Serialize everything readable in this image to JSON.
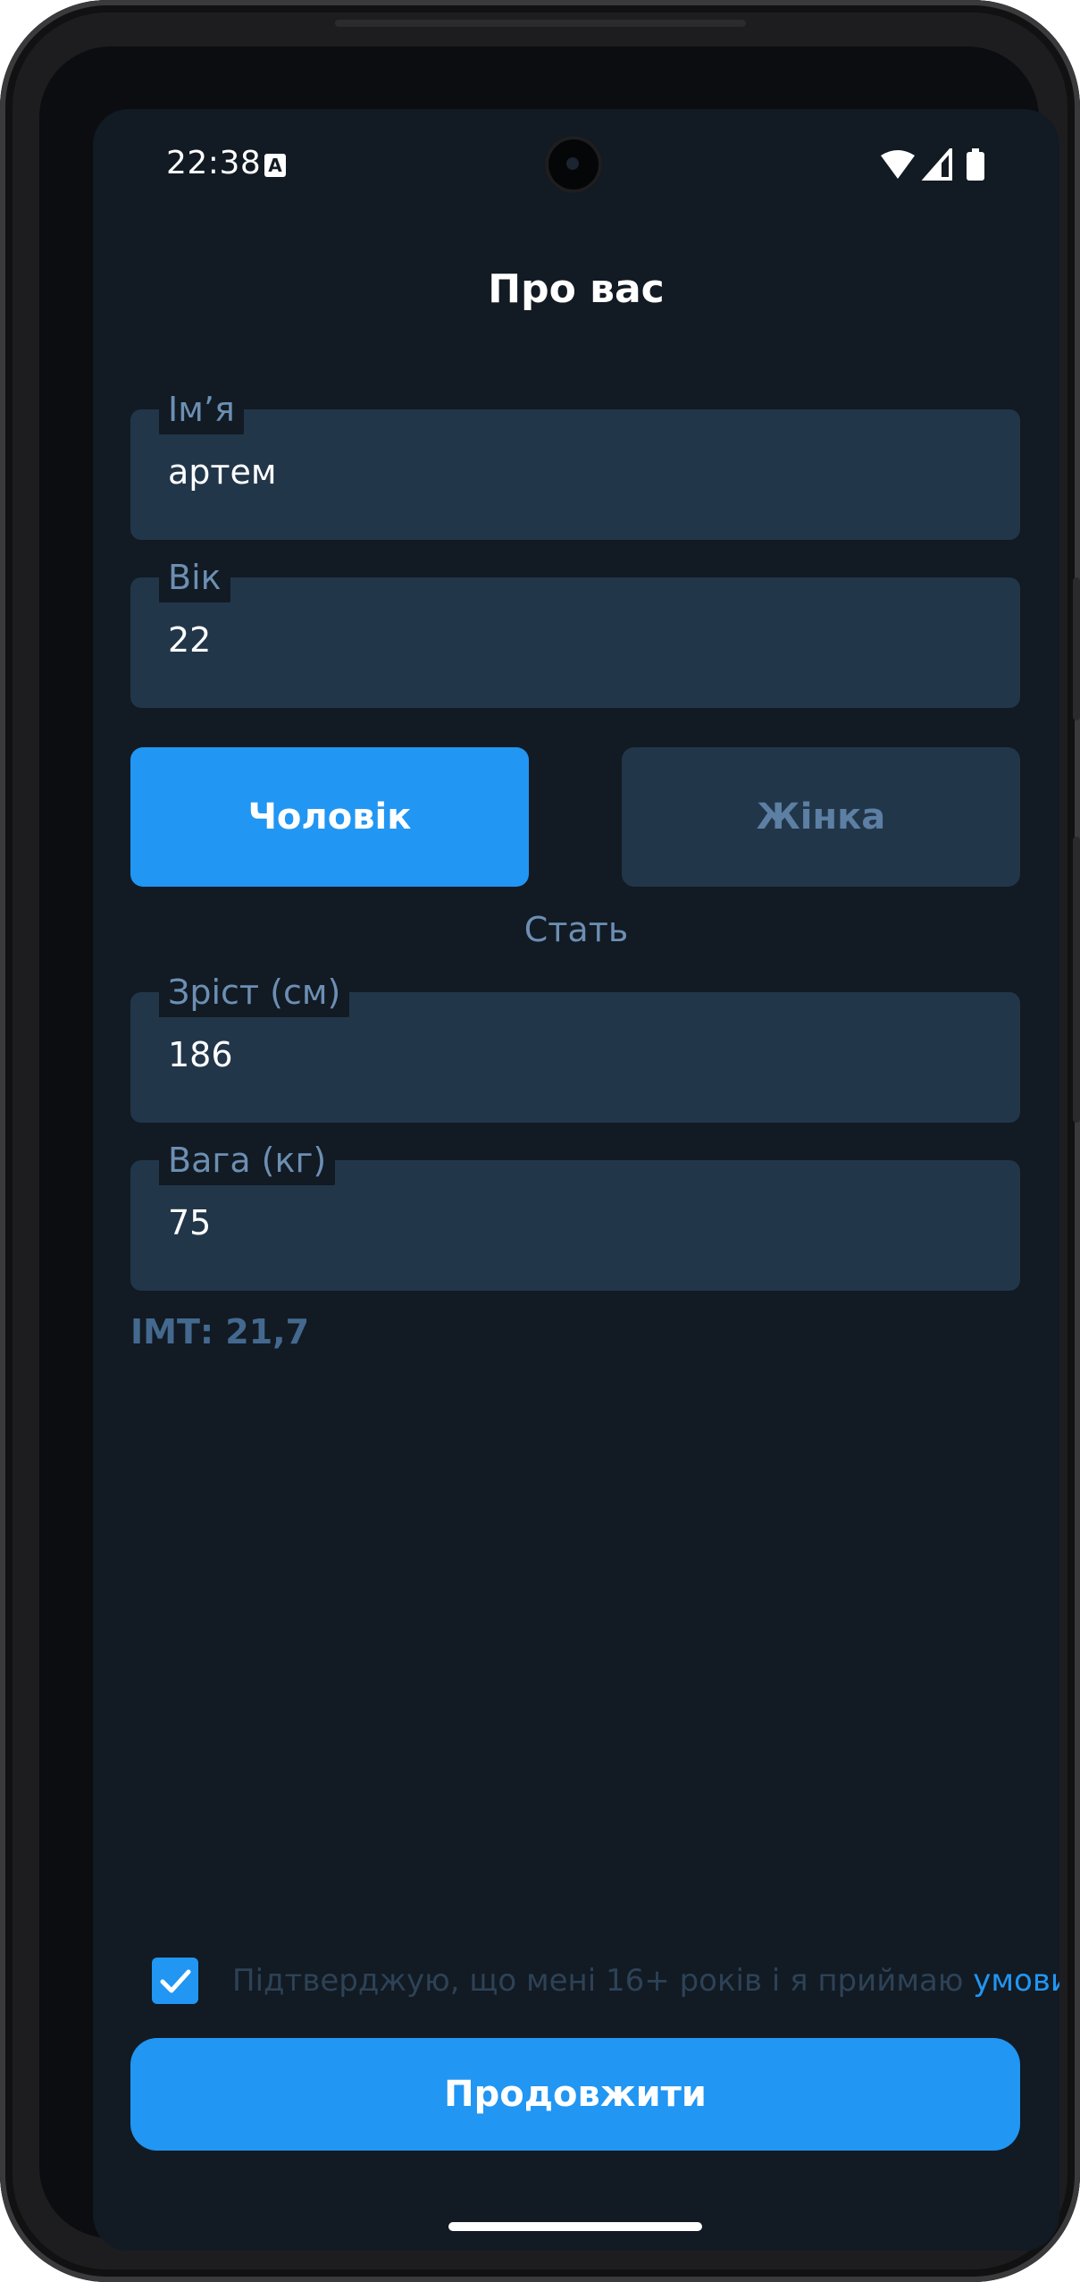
{
  "status_bar": {
    "time": "22:38",
    "notification_icon": "A"
  },
  "screen": {
    "title": "Про вас"
  },
  "fields": {
    "name": {
      "label": "Імʼя",
      "value": "артем"
    },
    "age": {
      "label": "Вік",
      "value": "22"
    },
    "height": {
      "label": "Зріст (см)",
      "value": "186"
    },
    "weight": {
      "label": "Вага (кг)",
      "value": "75"
    }
  },
  "gender": {
    "male_label": "Чоловік",
    "female_label": "Жінка",
    "caption": "Стать",
    "selected": "male"
  },
  "bmi": {
    "text": "ІМТ: 21,7"
  },
  "consent": {
    "checked": true,
    "text": "Підтверджую, що мені 16+ років і я приймаю ",
    "link": "умови."
  },
  "actions": {
    "continue_label": "Продовжити"
  },
  "colors": {
    "background": "#121a23",
    "field": "#22364a",
    "accent": "#2196f3",
    "label": "#6c8fb3"
  }
}
